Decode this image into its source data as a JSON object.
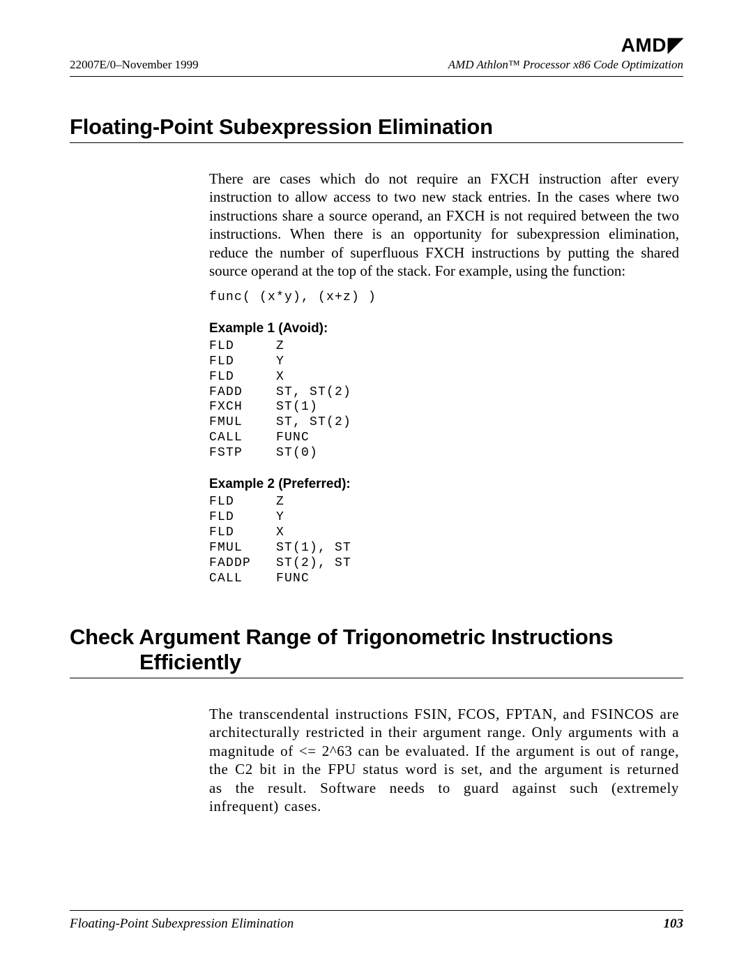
{
  "brand": "AMD",
  "header": {
    "left": "22007E/0–November 1999",
    "right": "AMD Athlon™ Processor x86 Code Optimization"
  },
  "section1": {
    "title": "Floating-Point Subexpression Elimination",
    "para": "There are cases which do not require an FXCH instruction after every instruction to allow access to two new stack entries. In the cases where two instructions share a source operand, an FXCH is not required between the two instructions. When there is an opportunity for subexpression elimination, reduce the number of superfluous FXCH instructions by putting the shared source operand at the top of the stack. For example, using the function:",
    "code0": "func( (x*y), (x+z) )",
    "ex1_title": "Example 1 (Avoid):",
    "ex1_code": "FLD     Z\nFLD     Y\nFLD     X\nFADD    ST, ST(2)\nFXCH    ST(1)\nFMUL    ST, ST(2)\nCALL    FUNC\nFSTP    ST(0)",
    "ex2_title": "Example 2 (Preferred):",
    "ex2_code": "FLD     Z\nFLD     Y\nFLD     X\nFMUL    ST(1), ST\nFADDP   ST(2), ST\nCALL    FUNC"
  },
  "section2": {
    "title": "Check Argument Range of Trigonometric Instructions Efficiently",
    "para": "The transcendental instructions FSIN, FCOS, FPTAN, and FSINCOS are architecturally restricted in their argument range. Only arguments with a magnitude of <= 2^63 can be evaluated. If the argument is out of range, the C2 bit in the FPU status word is set, and the argument is returned as the result. Software needs to guard against such (extremely infrequent) cases."
  },
  "footer": {
    "left": "Floating-Point Subexpression Elimination",
    "page": "103"
  }
}
